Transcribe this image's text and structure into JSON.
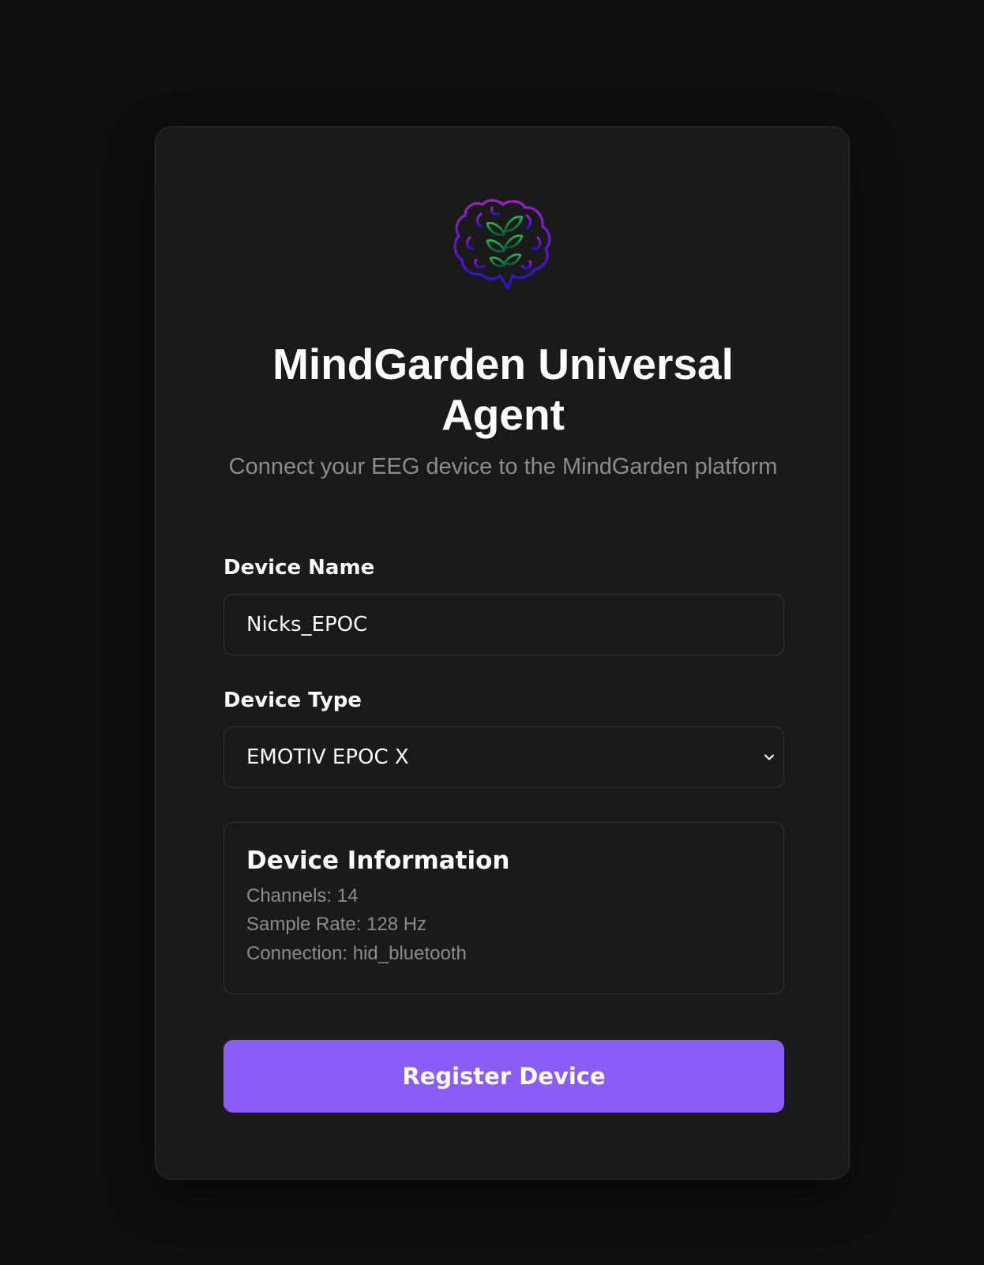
{
  "app": {
    "title": "MindGarden Universal Agent",
    "subtitle": "Connect your EEG device to the MindGarden platform",
    "logo_icon": "brain-plant-icon",
    "accent_color": "#8b5cf6",
    "logo_colors": {
      "brain_top": "#a020c0",
      "brain_bottom": "#2a10d0",
      "leaves": "#1aa84c"
    }
  },
  "form": {
    "device_name": {
      "label": "Device Name",
      "value": "Nicks_EPOC"
    },
    "device_type": {
      "label": "Device Type",
      "selected": "EMOTIV EPOC X",
      "dropdown_icon": "chevron-down-icon"
    }
  },
  "device_info": {
    "title": "Device Information",
    "channels": "Channels: 14",
    "sample_rate": "Sample Rate: 128 Hz",
    "connection": "Connection: hid_bluetooth"
  },
  "actions": {
    "register_label": "Register Device"
  }
}
